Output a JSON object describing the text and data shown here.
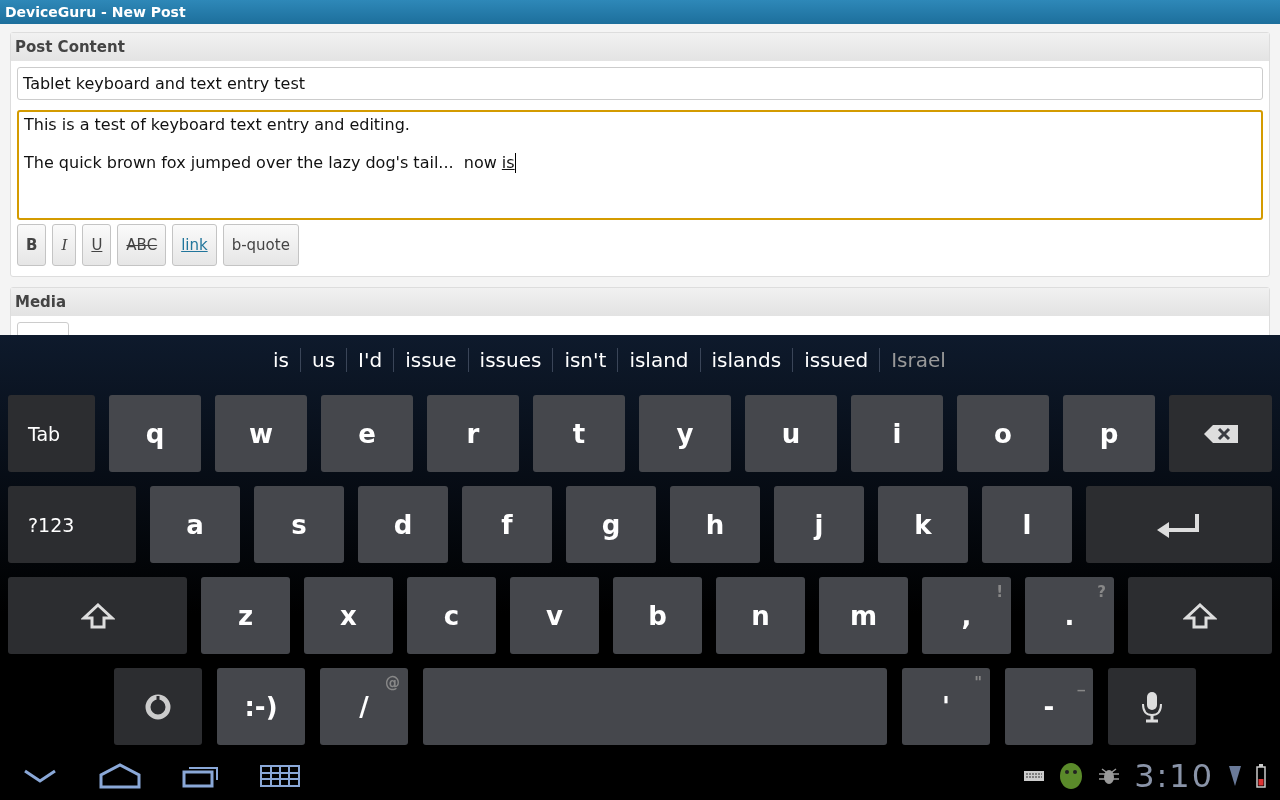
{
  "window": {
    "title": "DeviceGuru - New Post"
  },
  "post_content": {
    "heading": "Post Content",
    "title_field": {
      "value": "Tablet keyboard and text entry test"
    },
    "body_field": {
      "focused": true,
      "lines": [
        "This is a test of keyboard text entry and editing.",
        "The quick brown fox jumped over the lazy dog's tail...  now "
      ],
      "composing": "is"
    },
    "format_buttons": [
      {
        "kind": "bold",
        "label": "B"
      },
      {
        "kind": "italic",
        "label": "I"
      },
      {
        "kind": "underline",
        "label": "U"
      },
      {
        "kind": "strike",
        "label": "ABC"
      },
      {
        "kind": "link",
        "label": "link"
      },
      {
        "kind": "plain",
        "label": "b-quote"
      }
    ]
  },
  "media": {
    "heading": "Media"
  },
  "suggestions": [
    {
      "word": "is",
      "dimmed": false
    },
    {
      "word": "us",
      "dimmed": false
    },
    {
      "word": "I'd",
      "dimmed": false
    },
    {
      "word": "issue",
      "dimmed": false
    },
    {
      "word": "issues",
      "dimmed": false
    },
    {
      "word": "isn't",
      "dimmed": false
    },
    {
      "word": "island",
      "dimmed": false
    },
    {
      "word": "islands",
      "dimmed": false
    },
    {
      "word": "issued",
      "dimmed": false
    },
    {
      "word": "Israel",
      "dimmed": true
    }
  ],
  "keyboard_rows": [
    [
      {
        "kind": "tab",
        "label": "Tab"
      },
      {
        "kind": "char",
        "label": "q"
      },
      {
        "kind": "char",
        "label": "w"
      },
      {
        "kind": "char",
        "label": "e"
      },
      {
        "kind": "char",
        "label": "r"
      },
      {
        "kind": "char",
        "label": "t"
      },
      {
        "kind": "char",
        "label": "y"
      },
      {
        "kind": "char",
        "label": "u"
      },
      {
        "kind": "char",
        "label": "i"
      },
      {
        "kind": "char",
        "label": "o"
      },
      {
        "kind": "char",
        "label": "p"
      },
      {
        "kind": "backspace"
      }
    ],
    [
      {
        "kind": "symbols",
        "label": "?123"
      },
      {
        "kind": "char",
        "label": "a"
      },
      {
        "kind": "char",
        "label": "s"
      },
      {
        "kind": "char",
        "label": "d"
      },
      {
        "kind": "char",
        "label": "f"
      },
      {
        "kind": "char",
        "label": "g"
      },
      {
        "kind": "char",
        "label": "h"
      },
      {
        "kind": "char",
        "label": "j"
      },
      {
        "kind": "char",
        "label": "k"
      },
      {
        "kind": "char",
        "label": "l"
      },
      {
        "kind": "enter"
      }
    ],
    [
      {
        "kind": "shift"
      },
      {
        "kind": "char",
        "label": "z"
      },
      {
        "kind": "char",
        "label": "x"
      },
      {
        "kind": "char",
        "label": "c"
      },
      {
        "kind": "char",
        "label": "v"
      },
      {
        "kind": "char",
        "label": "b"
      },
      {
        "kind": "char",
        "label": "n"
      },
      {
        "kind": "char",
        "label": "m"
      },
      {
        "kind": "char",
        "label": ",",
        "hint": "!"
      },
      {
        "kind": "char",
        "label": ".",
        "hint": "?"
      },
      {
        "kind": "shift_right"
      }
    ],
    [
      {
        "kind": "settings"
      },
      {
        "kind": "char",
        "label": ":-)"
      },
      {
        "kind": "char",
        "label": "/",
        "hint": "@"
      },
      {
        "kind": "space"
      },
      {
        "kind": "char",
        "label": "'",
        "hint": "\""
      },
      {
        "kind": "char",
        "label": "-",
        "hint": "_"
      },
      {
        "kind": "mic"
      }
    ]
  ],
  "status_bar": {
    "time": "3:10"
  }
}
